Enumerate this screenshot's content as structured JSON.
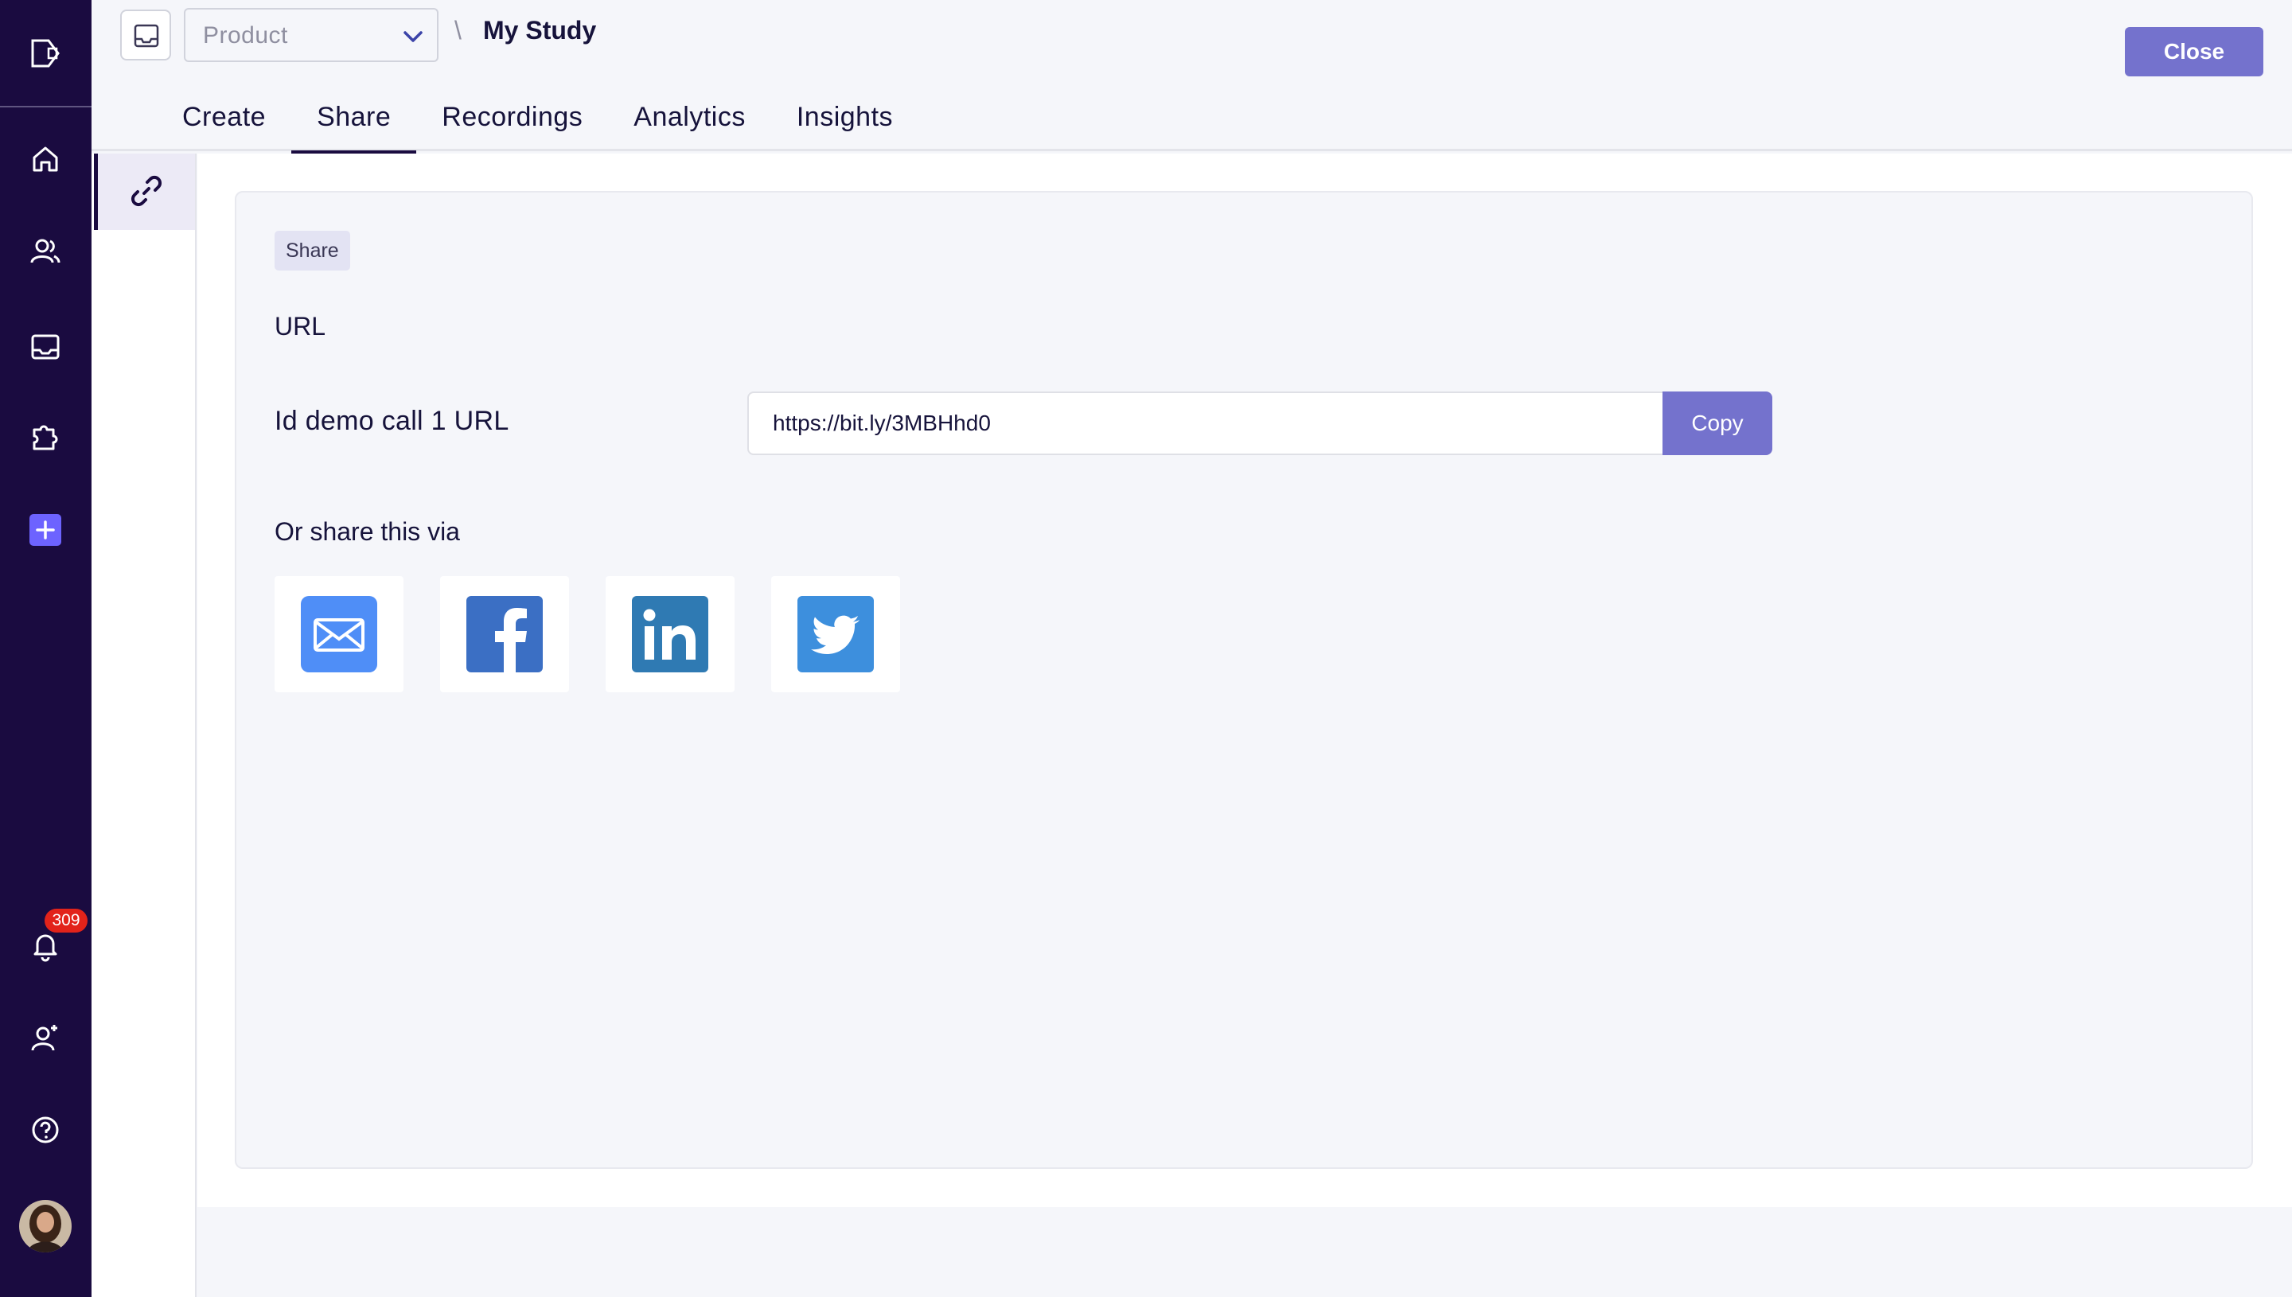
{
  "rail": {
    "icons": [
      "logo-icon",
      "home-icon",
      "users-icon",
      "inbox-icon",
      "puzzle-icon",
      "plus-icon",
      "bell-icon",
      "add-user-icon",
      "help-icon"
    ],
    "notification_count": "309",
    "accent": "#1a0b40"
  },
  "header": {
    "product_select": "Product",
    "breadcrumb_separator": "\\",
    "study_title": "My Study",
    "close_label": "Close"
  },
  "tabs": [
    {
      "label": "Create"
    },
    {
      "label": "Share",
      "active": true
    },
    {
      "label": "Recordings"
    },
    {
      "label": "Analytics"
    },
    {
      "label": "Insights"
    }
  ],
  "share": {
    "pill": "Share",
    "section_title": "URL",
    "url_label": "Id demo call 1 URL",
    "url_value": "https://bit.ly/3MBHhd0",
    "copy_label": "Copy",
    "share_via": "Or share this via",
    "services": [
      "email-icon",
      "facebook-icon",
      "linkedin-icon",
      "twitter-icon"
    ]
  },
  "colors": {
    "button": "#7472cd",
    "rail": "#1a0b40",
    "badge": "#e2231a"
  }
}
